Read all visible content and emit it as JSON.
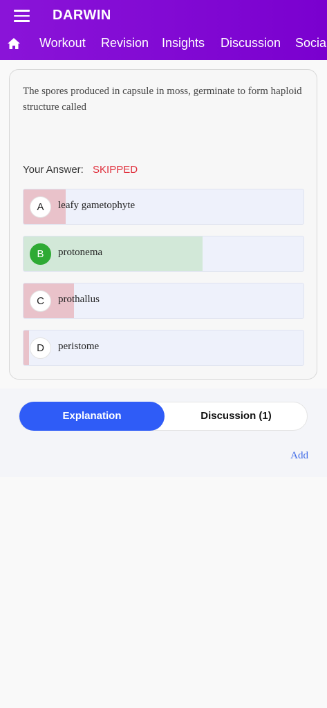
{
  "app": {
    "title": "DARWIN"
  },
  "nav": {
    "home_icon": "home-icon",
    "items": [
      "Workout",
      "Revision",
      "Insights",
      "Discussion",
      "Social"
    ]
  },
  "question": {
    "text": "The spores produced in capsule in moss, germinate to form haploid structure called",
    "answer_label": "Your Answer:",
    "answer_value": "SKIPPED",
    "options": [
      {
        "letter": "A",
        "text": "leafy gametophyte",
        "response_share": 0.15,
        "status": "incorrect"
      },
      {
        "letter": "B",
        "text": "protonema",
        "response_share": 0.64,
        "status": "correct"
      },
      {
        "letter": "C",
        "text": "prothallus",
        "response_share": 0.18,
        "status": "incorrect"
      },
      {
        "letter": "D",
        "text": "peristome",
        "response_share": 0.02,
        "status": "incorrect"
      }
    ]
  },
  "tabs": {
    "explanation": "Explanation",
    "discussion": "Discussion (1)"
  },
  "add_label": "Add",
  "colors": {
    "header": "#7a00cf",
    "correct_fill": "#d2e8d8",
    "incorrect_fill": "#e9c2ca",
    "skipped": "#e0303d",
    "accent": "#2f5cf7"
  }
}
